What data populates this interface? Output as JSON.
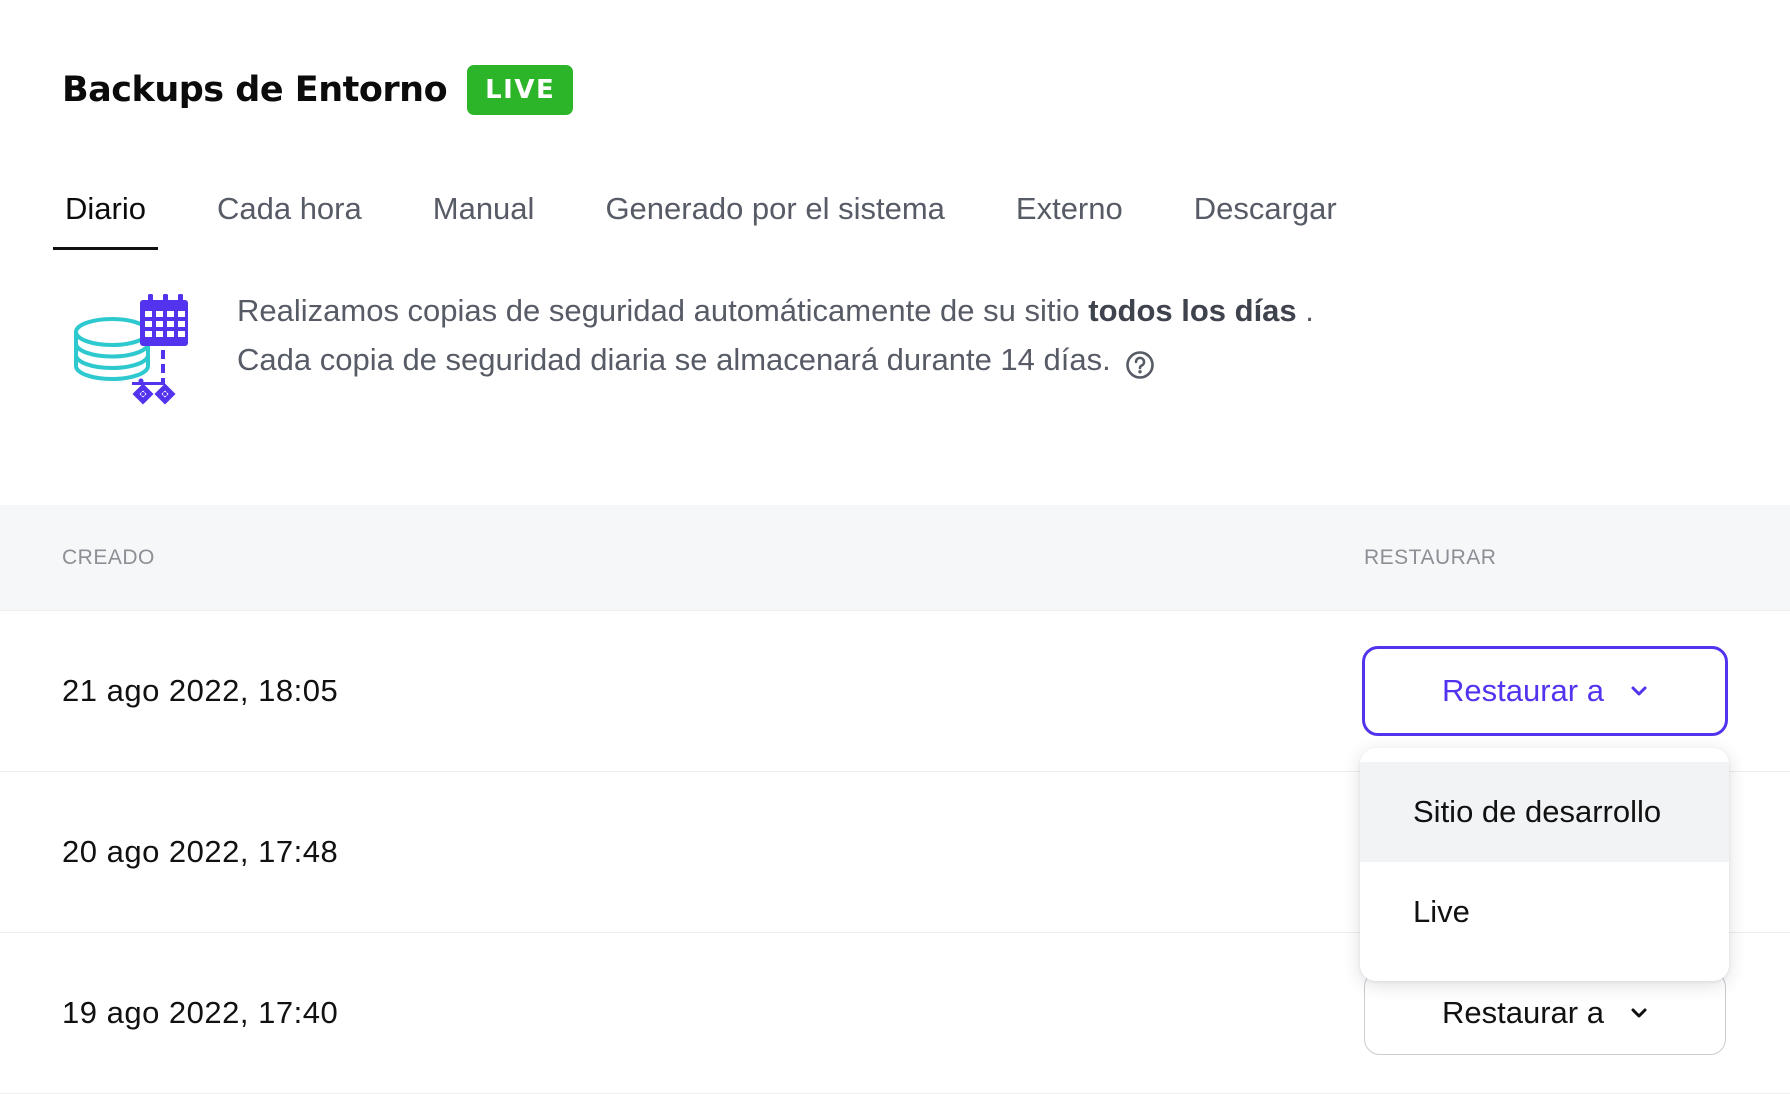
{
  "header": {
    "title": "Backups de Entorno",
    "badge": "LIVE"
  },
  "tabs": [
    {
      "label": "Diario",
      "active": true
    },
    {
      "label": "Cada hora",
      "active": false
    },
    {
      "label": "Manual",
      "active": false
    },
    {
      "label": "Generado por el sistema",
      "active": false
    },
    {
      "label": "Externo",
      "active": false
    },
    {
      "label": "Descargar",
      "active": false
    }
  ],
  "info": {
    "icon": "database-calendar-icon",
    "line1_prefix": "Realizamos copias de seguridad automáticamente de su sitio ",
    "line1_bold": "todos los días",
    "line1_suffix": " .",
    "line2": "Cada copia de seguridad diaria se almacenará durante 14 días.",
    "help_icon": "question-circle-icon"
  },
  "table": {
    "columns": {
      "created": "CREADO",
      "restore": "RESTAURAR"
    },
    "rows": [
      {
        "created": "21 ago 2022, 18:05",
        "restore_label": "Restaurar a",
        "open": true
      },
      {
        "created": "20 ago 2022, 17:48",
        "restore_label": "Restaurar a",
        "open": false
      },
      {
        "created": "19 ago 2022, 17:40",
        "restore_label": "Restaurar a",
        "open": false
      }
    ]
  },
  "dropdown": {
    "options": [
      "Sitio de desarrollo",
      "Live"
    ],
    "highlighted": "Sitio de desarrollo"
  },
  "colors": {
    "accent": "#5333ed",
    "live_badge": "#2db52a",
    "icon_teal": "#2ec9cf",
    "icon_purple": "#5333ed"
  }
}
